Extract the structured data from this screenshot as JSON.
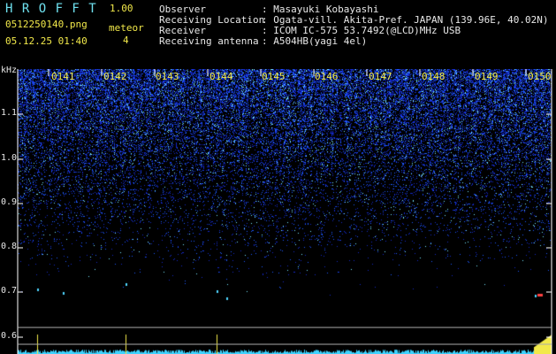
{
  "header": {
    "app_name": "H R O F F T",
    "version": "1.00",
    "filename": "0512250140.png",
    "datetime": "05.12.25 01:40",
    "meteor_label": "meteor",
    "meteor_count": "4",
    "info": [
      {
        "label": "Observer",
        "value": ": Masayuki Kobayashi"
      },
      {
        "label": "Receiving Location",
        "value": ": Ogata-vill. Akita-Pref. JAPAN (139.96E, 40.02N)"
      },
      {
        "label": "Receiver",
        "value": ": ICOM IC-575 53.7492(@LCD)MHz USB"
      },
      {
        "label": "Receiving antenna",
        "value": ": A504HB(yagi 4el)"
      }
    ]
  },
  "axis": {
    "unit": "kHz",
    "y_ticks": [
      "1.1",
      "1.0",
      "0.9",
      "0.8",
      "0.7",
      "0.6"
    ],
    "time_labels": [
      "0141",
      "0142",
      "0143",
      "0144",
      "0145",
      "0146",
      "0147",
      "0148",
      "0149",
      "0150"
    ]
  },
  "colors": {
    "text_yellow": "#f2e94a",
    "text_cyan": "#6fe1ef",
    "signal_blue": "#2a4cff",
    "signal_cyan": "#3fd3ff",
    "background": "#000000"
  }
}
